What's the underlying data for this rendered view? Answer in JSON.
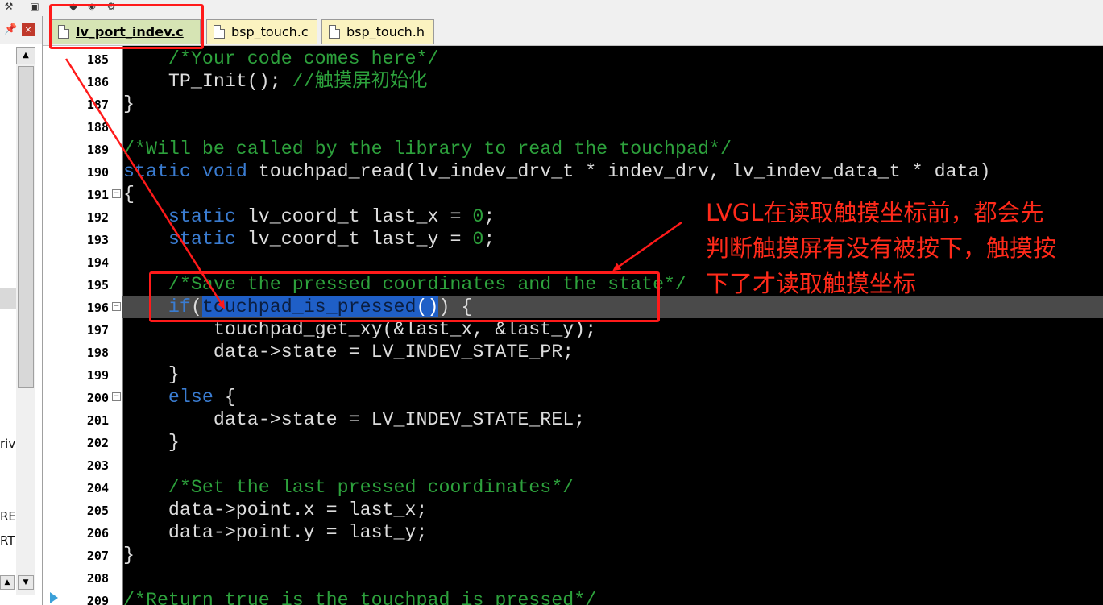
{
  "tabs": [
    {
      "label": "lv_port_indev.c"
    },
    {
      "label": "bsp_touch.c"
    },
    {
      "label": "bsp_touch.h"
    }
  ],
  "left_panel": {
    "pin_icon": "pin-icon",
    "close_icon": "close-icon",
    "fragments": [
      "riv",
      "RE",
      "RT"
    ]
  },
  "code_lines": [
    {
      "num": "185",
      "text": "    /*Your code comes here*/"
    },
    {
      "num": "186",
      "text": "    TP_Init(); //触摸屏初始化"
    },
    {
      "num": "187",
      "text": "}"
    },
    {
      "num": "188",
      "text": ""
    },
    {
      "num": "189",
      "text": "/*Will be called by the library to read the touchpad*/"
    },
    {
      "num": "190",
      "text": "static void touchpad_read(lv_indev_drv_t * indev_drv, lv_indev_data_t * data)"
    },
    {
      "num": "191",
      "text": "{"
    },
    {
      "num": "192",
      "text": "    static lv_coord_t last_x = 0;"
    },
    {
      "num": "193",
      "text": "    static lv_coord_t last_y = 0;"
    },
    {
      "num": "194",
      "text": ""
    },
    {
      "num": "195",
      "text": "    /*Save the pressed coordinates and the state*/"
    },
    {
      "num": "196",
      "text": "    if(touchpad_is_pressed()) {"
    },
    {
      "num": "197",
      "text": "        touchpad_get_xy(&last_x, &last_y);"
    },
    {
      "num": "198",
      "text": "        data->state = LV_INDEV_STATE_PR;"
    },
    {
      "num": "199",
      "text": "    }"
    },
    {
      "num": "200",
      "text": "    else {"
    },
    {
      "num": "201",
      "text": "        data->state = LV_INDEV_STATE_REL;"
    },
    {
      "num": "202",
      "text": "    }"
    },
    {
      "num": "203",
      "text": ""
    },
    {
      "num": "204",
      "text": "    /*Set the last pressed coordinates*/"
    },
    {
      "num": "205",
      "text": "    data->point.x = last_x;"
    },
    {
      "num": "206",
      "text": "    data->point.y = last_y;"
    },
    {
      "num": "207",
      "text": "}"
    },
    {
      "num": "208",
      "text": ""
    },
    {
      "num": "209",
      "text": "/*Return true is the touchpad is pressed*/"
    }
  ],
  "annotation": {
    "callout": "LVGL在读取触摸坐标前，都会先\n判断触摸屏有没有被按下，触摸按\n下了才读取触摸坐标"
  },
  "colors": {
    "editor_bg": "#000000",
    "comment": "#2da13c",
    "keyword": "#3a7cd1",
    "selection": "#1f5fc7",
    "annotation_red": "#ff1a1a",
    "active_tab": "#d6e4b4",
    "inactive_tab": "#fbf3c0"
  }
}
